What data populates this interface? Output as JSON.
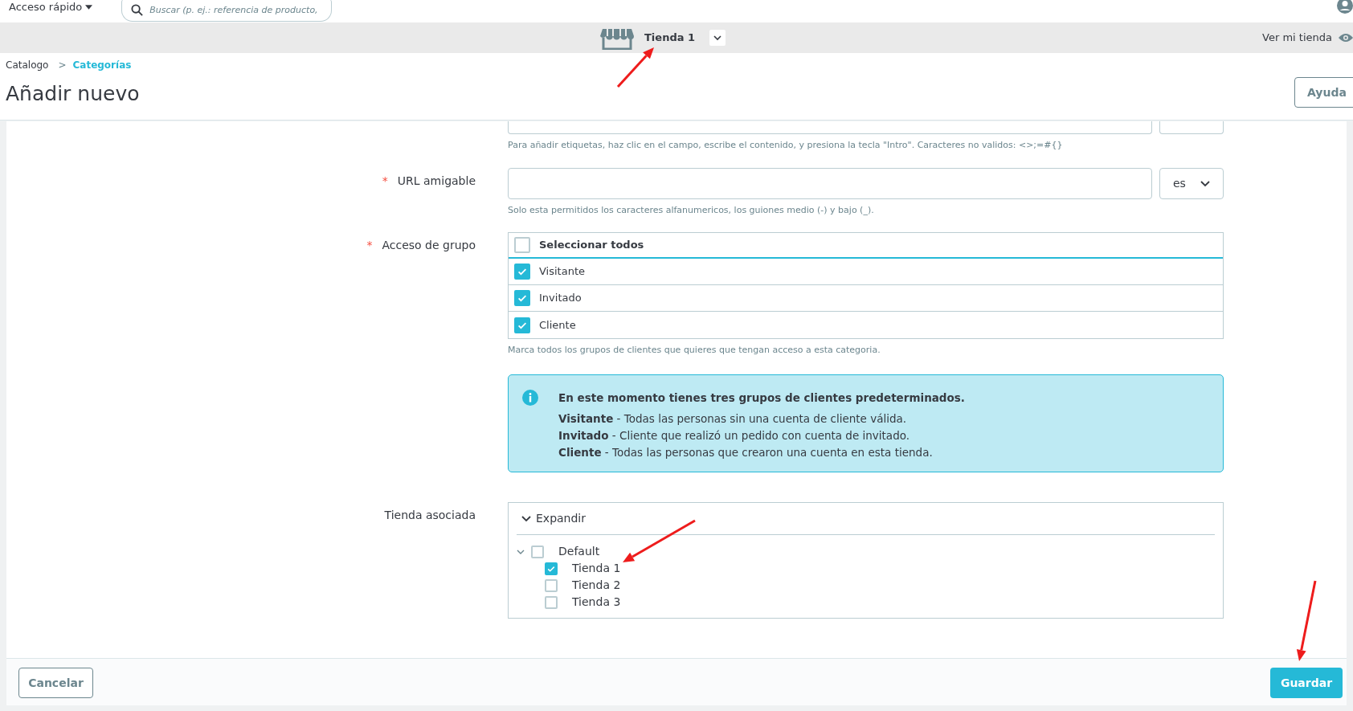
{
  "topbar": {
    "quick_access": "Acceso rápido",
    "search": {
      "placeholder": "Buscar (p. ej.: referencia de producto,"
    }
  },
  "shop_bar": {
    "shop": "Tienda 1",
    "view_shop": "Ver mi tienda"
  },
  "breadcrumb": [
    {
      "label": "Catalogo",
      "current": false
    },
    {
      "label": "Categorías",
      "current": true
    }
  ],
  "breadcrumb_separator": ">",
  "title": "Añadir nuevo",
  "help_button": "Ayuda",
  "tags_help": "Para añadir etiquetas, haz clic en el campo, escribe el contenido, y presiona la tecla \"Intro\". Caracteres no validos: <>;=#{}",
  "url_field": {
    "label": "URL amigable",
    "required_mark": "*",
    "language": "es",
    "help": "Solo esta permitidos los caracteres alfanumericos, los guiones medio (-) y bajo (_)."
  },
  "group_access": {
    "label": "Acceso de grupo",
    "required_mark": "*",
    "select_all": {
      "label": "Seleccionar todos",
      "checked": false
    },
    "groups": [
      {
        "label": "Visitante",
        "checked": true
      },
      {
        "label": "Invitado",
        "checked": true
      },
      {
        "label": "Cliente",
        "checked": true
      }
    ],
    "help": "Marca todos los grupos de clientes que quieres que tengan acceso a esta categoria."
  },
  "info": {
    "title": "En este momento tienes tres grupos de clientes predeterminados.",
    "lines": [
      "**Visitante** - Todas las personas sin una cuenta de cliente válida.",
      "**Invitado** - Cliente que realizó un pedido con cuenta de invitado.",
      "**Cliente** - Todas las personas que crearon una cuenta en esta tienda."
    ]
  },
  "shop_association": {
    "label": "Tienda asociada",
    "expand": "Expandir",
    "tree": [
      {
        "label": "Default",
        "checked": false,
        "expanded": true,
        "children": [
          {
            "label": "Tienda 1",
            "checked": true
          },
          {
            "label": "Tienda 2",
            "checked": false
          },
          {
            "label": "Tienda 3",
            "checked": false
          }
        ]
      }
    ]
  },
  "footer": {
    "cancel": "Cancelar",
    "save": "Guardar"
  }
}
